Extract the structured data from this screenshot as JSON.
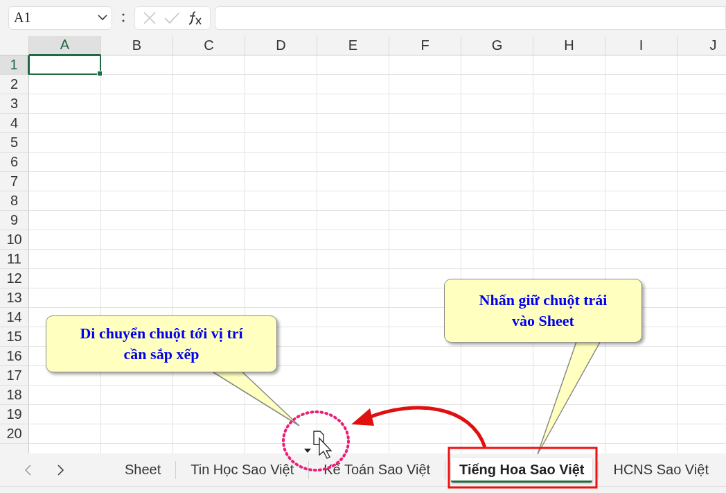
{
  "formula_bar": {
    "name_box": "A1"
  },
  "columns": [
    {
      "label": "A",
      "selected": true
    },
    {
      "label": "B",
      "selected": false
    },
    {
      "label": "C",
      "selected": false
    },
    {
      "label": "D",
      "selected": false
    },
    {
      "label": "E",
      "selected": false
    },
    {
      "label": "F",
      "selected": false
    },
    {
      "label": "G",
      "selected": false
    },
    {
      "label": "H",
      "selected": false
    },
    {
      "label": "I",
      "selected": false
    },
    {
      "label": "J",
      "selected": false
    }
  ],
  "rows": [
    {
      "label": "1",
      "selected": true
    },
    {
      "label": "2",
      "selected": false
    },
    {
      "label": "3",
      "selected": false
    },
    {
      "label": "4",
      "selected": false
    },
    {
      "label": "5",
      "selected": false
    },
    {
      "label": "6",
      "selected": false
    },
    {
      "label": "7",
      "selected": false
    },
    {
      "label": "8",
      "selected": false
    },
    {
      "label": "9",
      "selected": false
    },
    {
      "label": "10",
      "selected": false
    },
    {
      "label": "11",
      "selected": false
    },
    {
      "label": "12",
      "selected": false
    },
    {
      "label": "13",
      "selected": false
    },
    {
      "label": "14",
      "selected": false
    },
    {
      "label": "15",
      "selected": false
    },
    {
      "label": "16",
      "selected": false
    },
    {
      "label": "17",
      "selected": false
    },
    {
      "label": "18",
      "selected": false
    },
    {
      "label": "19",
      "selected": false
    },
    {
      "label": "20",
      "selected": false
    }
  ],
  "sheet_tabs": [
    {
      "label": "Sheet",
      "selected": false
    },
    {
      "label": "Tin Học Sao Việt",
      "selected": false
    },
    {
      "label": "Kế Toán Sao Việt",
      "selected": false
    },
    {
      "label": "Tiếng Hoa Sao Việt",
      "selected": true
    },
    {
      "label": "HCNS Sao Việt",
      "selected": false
    }
  ],
  "callouts": [
    {
      "text": "Di chuyển chuột tới vị trí cần sắp xếp",
      "kind": "left"
    },
    {
      "text": "Nhấn giữ chuột trái vào Sheet",
      "kind": "right"
    }
  ]
}
